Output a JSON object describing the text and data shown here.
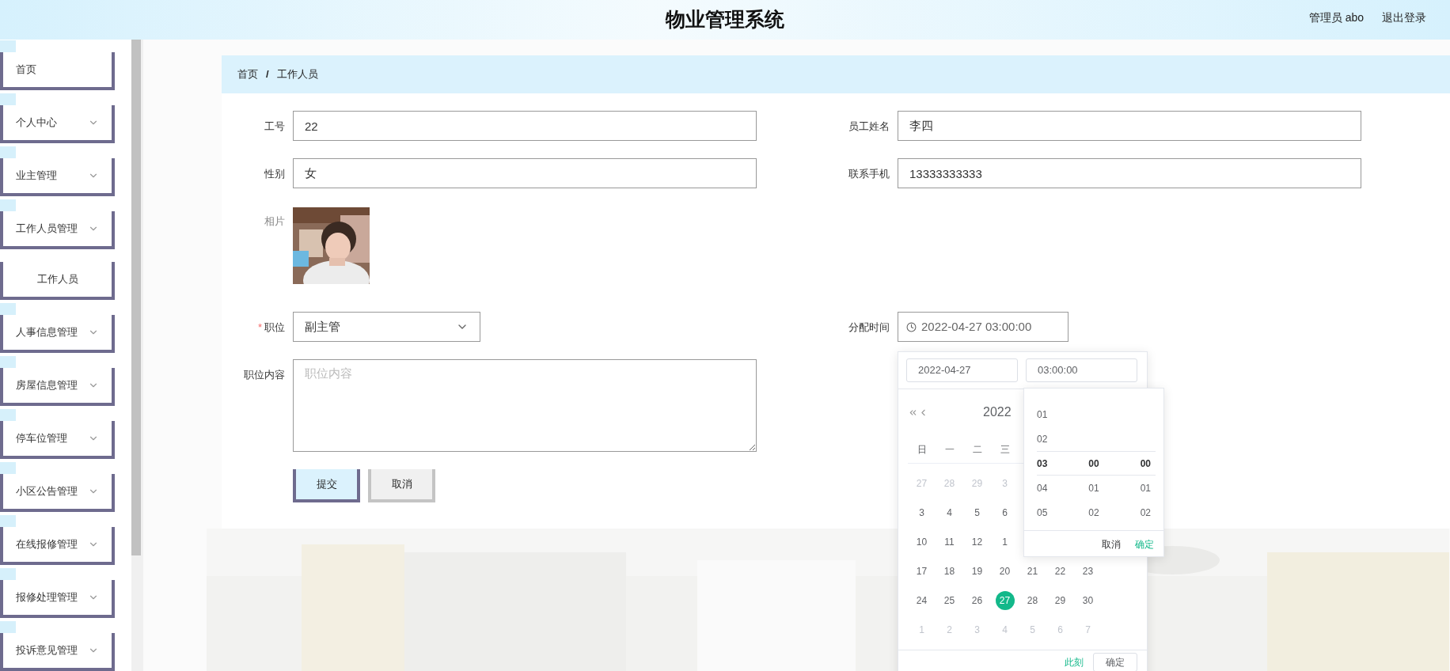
{
  "header": {
    "title": "物业管理系统",
    "user": "管理员 abo",
    "logout": "退出登录"
  },
  "sidebar": {
    "items": [
      {
        "label": "首页",
        "kind": "link"
      },
      {
        "label": "个人中心",
        "kind": "menu"
      },
      {
        "label": "业主管理",
        "kind": "menu"
      },
      {
        "label": "工作人员管理",
        "kind": "menu"
      },
      {
        "label": "工作人员",
        "kind": "sub"
      },
      {
        "label": "人事信息管理",
        "kind": "menu"
      },
      {
        "label": "房屋信息管理",
        "kind": "menu"
      },
      {
        "label": "停车位管理",
        "kind": "menu"
      },
      {
        "label": "小区公告管理",
        "kind": "menu"
      },
      {
        "label": "在线报修管理",
        "kind": "menu"
      },
      {
        "label": "报修处理管理",
        "kind": "menu"
      },
      {
        "label": "投诉意见管理",
        "kind": "menu"
      }
    ]
  },
  "breadcrumb": {
    "items": [
      "首页",
      "工作人员"
    ],
    "separator": "/"
  },
  "form": {
    "rows": [
      [
        {
          "label": "工号",
          "kind": "input",
          "value": "22"
        },
        {
          "label": "员工姓名",
          "kind": "input",
          "value": "李四"
        }
      ],
      [
        {
          "label": "性别",
          "kind": "input",
          "value": "女"
        },
        {
          "label": "联系手机",
          "kind": "input",
          "value": "13333333333"
        }
      ],
      [
        {
          "label": "相片"
        }
      ],
      [
        {
          "label": "职位",
          "kind": "select",
          "value": "副主管",
          "required_mark": "*"
        },
        {
          "label": "分配时间",
          "kind": "datetime",
          "value": "2022-04-27 03:00:00"
        }
      ],
      [
        {
          "label": "职位内容",
          "kind": "textarea",
          "placeholder": "职位内容"
        }
      ]
    ],
    "buttons": [
      {
        "label": "提交",
        "kind": "primary"
      },
      {
        "label": "取消",
        "kind": "secondary"
      }
    ]
  },
  "date_picker": {
    "date": "2022-04-27",
    "time": "03:00:00",
    "year": "2022",
    "weekdays": [
      "日",
      "一",
      "二",
      "三"
    ],
    "weeks": [
      [
        {
          "text": "27",
          "muted": true,
          "selected": false
        },
        {
          "text": "28",
          "muted": true,
          "selected": false
        },
        {
          "text": "29",
          "muted": true,
          "selected": false
        },
        {
          "text": "3",
          "muted": true,
          "selected": false
        }
      ],
      [
        {
          "text": "3",
          "muted": false,
          "selected": false
        },
        {
          "text": "4",
          "muted": false,
          "selected": false
        },
        {
          "text": "5",
          "muted": false,
          "selected": false
        },
        {
          "text": "6",
          "muted": false,
          "selected": false
        }
      ],
      [
        {
          "text": "10",
          "muted": false,
          "selected": false
        },
        {
          "text": "11",
          "muted": false,
          "selected": false
        },
        {
          "text": "12",
          "muted": false,
          "selected": false
        },
        {
          "text": "1",
          "muted": false,
          "selected": false
        }
      ],
      [
        {
          "text": "17",
          "muted": false,
          "selected": false
        },
        {
          "text": "18",
          "muted": false,
          "selected": false
        },
        {
          "text": "19",
          "muted": false,
          "selected": false
        },
        {
          "text": "20",
          "muted": false,
          "selected": false
        },
        {
          "text": "21",
          "muted": false,
          "selected": false
        },
        {
          "text": "22",
          "muted": false,
          "selected": false
        },
        {
          "text": "23",
          "muted": false,
          "selected": false
        }
      ],
      [
        {
          "text": "24",
          "muted": false,
          "selected": false
        },
        {
          "text": "25",
          "muted": false,
          "selected": false
        },
        {
          "text": "26",
          "muted": false,
          "selected": false
        },
        {
          "text": "27",
          "muted": false,
          "selected": true
        },
        {
          "text": "28",
          "muted": false,
          "selected": false
        },
        {
          "text": "29",
          "muted": false,
          "selected": false
        },
        {
          "text": "30",
          "muted": false,
          "selected": false
        }
      ],
      [
        {
          "text": "1",
          "muted": true,
          "selected": false
        },
        {
          "text": "2",
          "muted": true,
          "selected": false
        },
        {
          "text": "3",
          "muted": true,
          "selected": false
        },
        {
          "text": "4",
          "muted": true,
          "selected": false
        },
        {
          "text": "5",
          "muted": true,
          "selected": false
        },
        {
          "text": "6",
          "muted": true,
          "selected": false
        },
        {
          "text": "7",
          "muted": true,
          "selected": false
        }
      ]
    ],
    "time_panel": {
      "columns": [
        [
          {
            "text": "01",
            "selected": false
          },
          {
            "text": "02",
            "selected": false
          },
          {
            "text": "03",
            "selected": true
          },
          {
            "text": "04",
            "selected": false
          },
          {
            "text": "05",
            "selected": false
          }
        ],
        [
          {
            "text": "00",
            "selected": true
          },
          {
            "text": "01",
            "selected": false
          },
          {
            "text": "02",
            "selected": false
          }
        ],
        [
          {
            "text": "00",
            "selected": true
          },
          {
            "text": "01",
            "selected": false
          },
          {
            "text": "02",
            "selected": false
          }
        ]
      ],
      "cancel": "取消",
      "confirm": "确定"
    },
    "now": "此刻",
    "confirm": "确定"
  }
}
